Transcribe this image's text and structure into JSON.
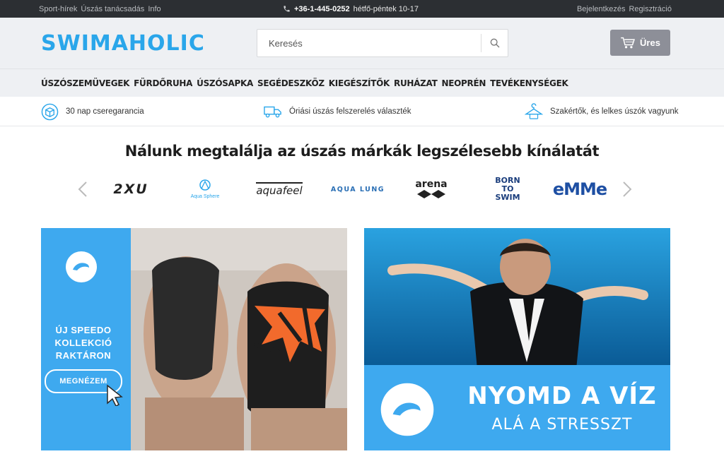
{
  "topbar": {
    "links_left": [
      "Sport-hírek",
      "Úszás tanácsadás",
      "Info"
    ],
    "phone": "+36-1-445-0252",
    "hours": "hétfő-péntek 10-17",
    "login": "Bejelentkezés",
    "register": "Regisztráció"
  },
  "header": {
    "logo": "SWIMAHOLIC",
    "search_placeholder": "Keresés",
    "cart_label": "Üres"
  },
  "nav": [
    "ÚSZÓSZEMÜVEGEK",
    "FÜRDŐRUHA",
    "ÚSZÓSAPKA",
    "SEGÉDESZKÖZ",
    "KIEGÉSZÍTŐK",
    "RUHÁZAT",
    "NEOPRÉN",
    "TEVÉKENYSÉGEK"
  ],
  "usp": [
    {
      "icon": "box-icon",
      "text": "30 nap cseregarancia"
    },
    {
      "icon": "truck-icon",
      "text": "Óriási úszás felszerelés választék"
    },
    {
      "icon": "hanger-icon",
      "text": "Szakértők, és lelkes úszók vagyunk"
    }
  ],
  "brands": {
    "title": "Nálunk megtalálja az úszás márkák legszélesebb kínálatát",
    "logos": [
      "2XU",
      "Aqua Sphere",
      "aquafeel",
      "AQUA LUNG",
      "arena",
      "BORN TO SWIM",
      "eMMe"
    ]
  },
  "banner_left": {
    "line1": "ÚJ SPEEDO",
    "line2": "KOLLEKCIÓ",
    "line3": "RAKTÁRON",
    "button": "MEGNÉZEM"
  },
  "banner_right": {
    "line1": "NYOMD A VÍZ",
    "line2": "ALÁ A STRESSZT"
  },
  "colors": {
    "brand": "#2aa6ea",
    "topbar": "#2c2f33",
    "header": "#eef0f3",
    "banner": "#3ea9ef"
  }
}
